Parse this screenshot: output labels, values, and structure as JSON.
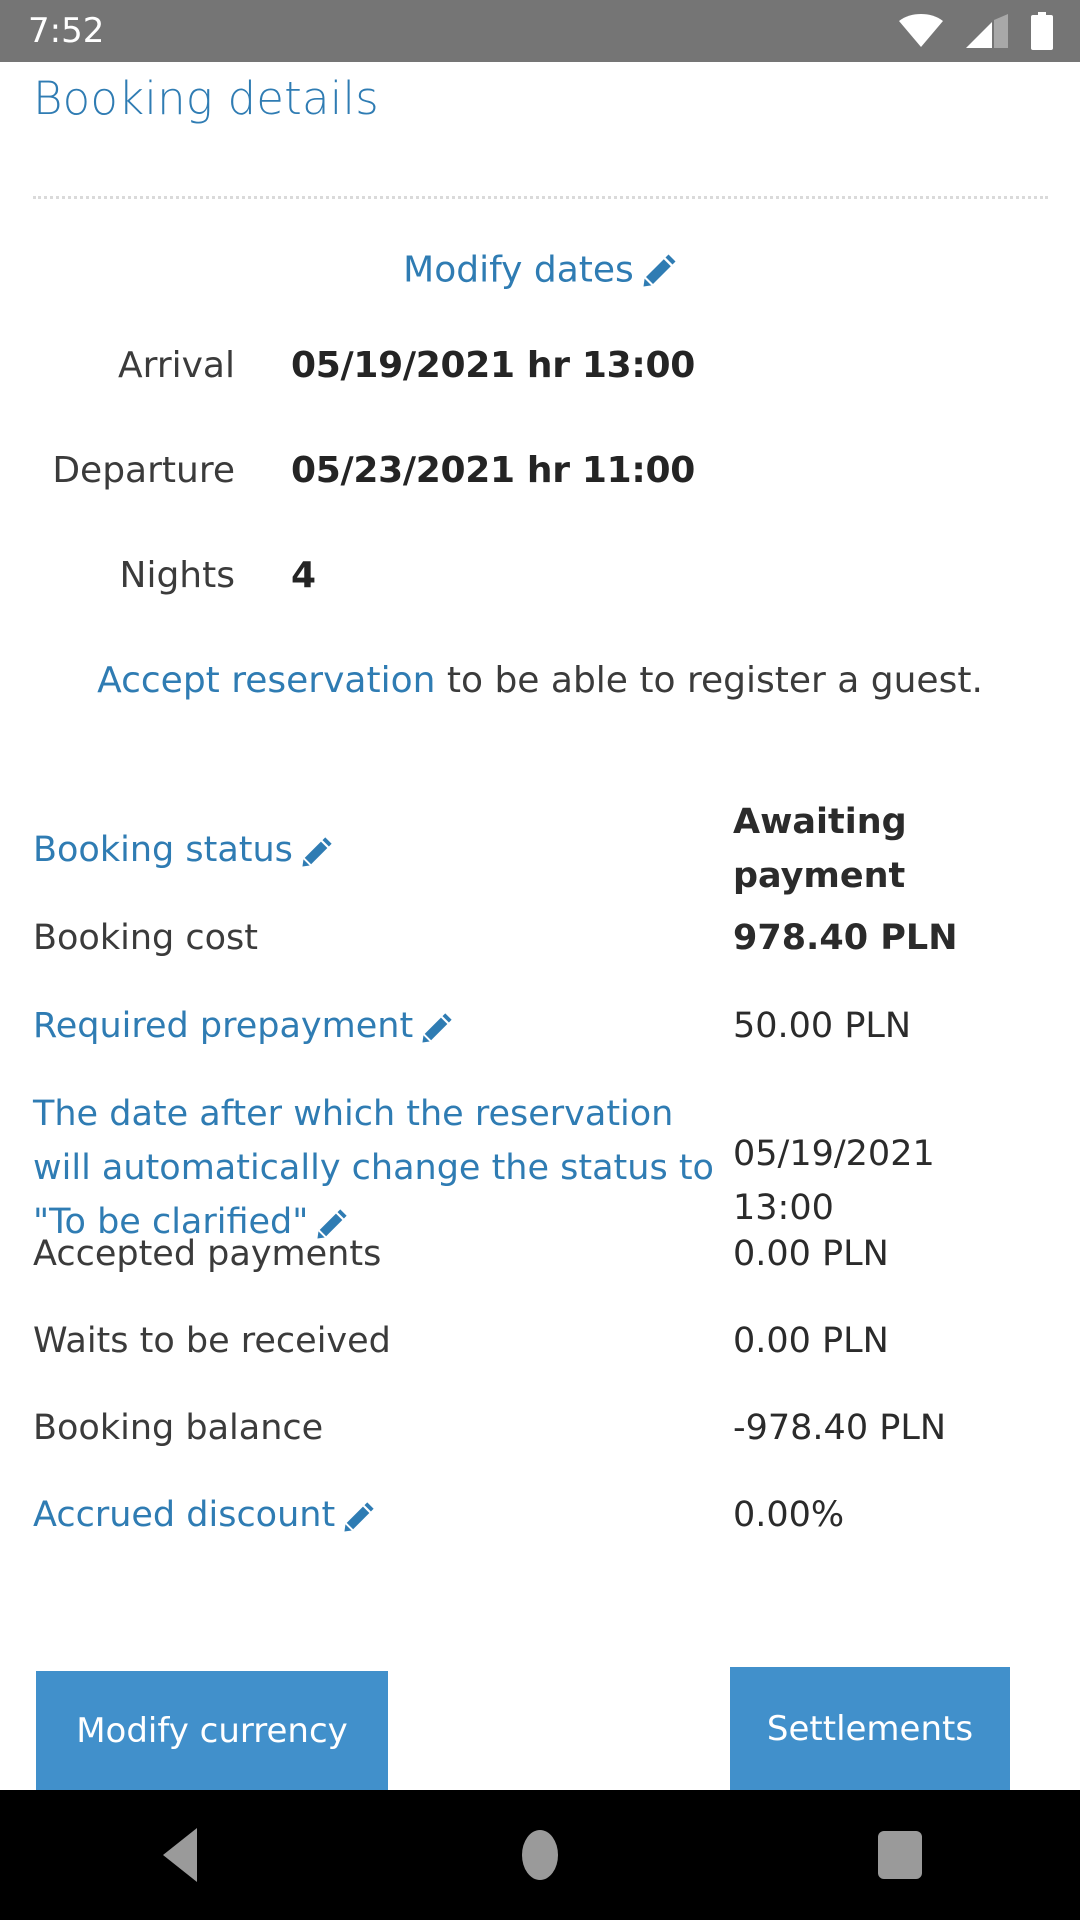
{
  "status_bar": {
    "time": "7:52",
    "icons": [
      "wifi-icon",
      "cellular-signal-icon",
      "battery-icon"
    ]
  },
  "header": {
    "title": "Booking details"
  },
  "dates_section": {
    "modify_link": "Modify dates",
    "modify_icon": "pencil-icon",
    "rows": [
      {
        "label": "Arrival",
        "value": "05/19/2021 hr 13:00"
      },
      {
        "label": "Departure",
        "value": "05/23/2021 hr 11:00"
      },
      {
        "label": "Nights",
        "value": "4"
      }
    ]
  },
  "notice": {
    "link_text": "Accept reservation",
    "rest_text": " to be able to register a guest."
  },
  "details": {
    "booking_status": {
      "label": "Booking status",
      "value_line1": "Awaiting",
      "value_line2": "payment"
    },
    "booking_cost": {
      "label": "Booking cost",
      "value": "978.40 PLN"
    },
    "required_prepayment": {
      "label": "Required prepayment",
      "value": "50.00 PLN"
    },
    "auto_status_date": {
      "label": "The date after which the reservation will automatically change the status to \"To be clarified\"",
      "value_line1": "05/19/2021",
      "value_line2": "13:00"
    },
    "accepted_payments": {
      "label": "Accepted payments",
      "value": "0.00 PLN"
    },
    "waits_to_be_received": {
      "label": "Waits to be received",
      "value": "0.00 PLN"
    },
    "booking_balance": {
      "label": "Booking balance",
      "value": "-978.40 PLN"
    },
    "accrued_discount": {
      "label": "Accrued discount",
      "value": "0.00%"
    }
  },
  "buttons": {
    "modify_currency": "Modify currency",
    "settlements": "Settlements"
  },
  "nav_bar": {
    "back": "back-icon",
    "home": "home-icon",
    "recents": "recents-icon"
  },
  "colors": {
    "accent_blue": "#2f7cb3",
    "button_blue": "#4190cb",
    "status_bar_gray": "#757575",
    "text_dark": "#3b3b3b"
  }
}
